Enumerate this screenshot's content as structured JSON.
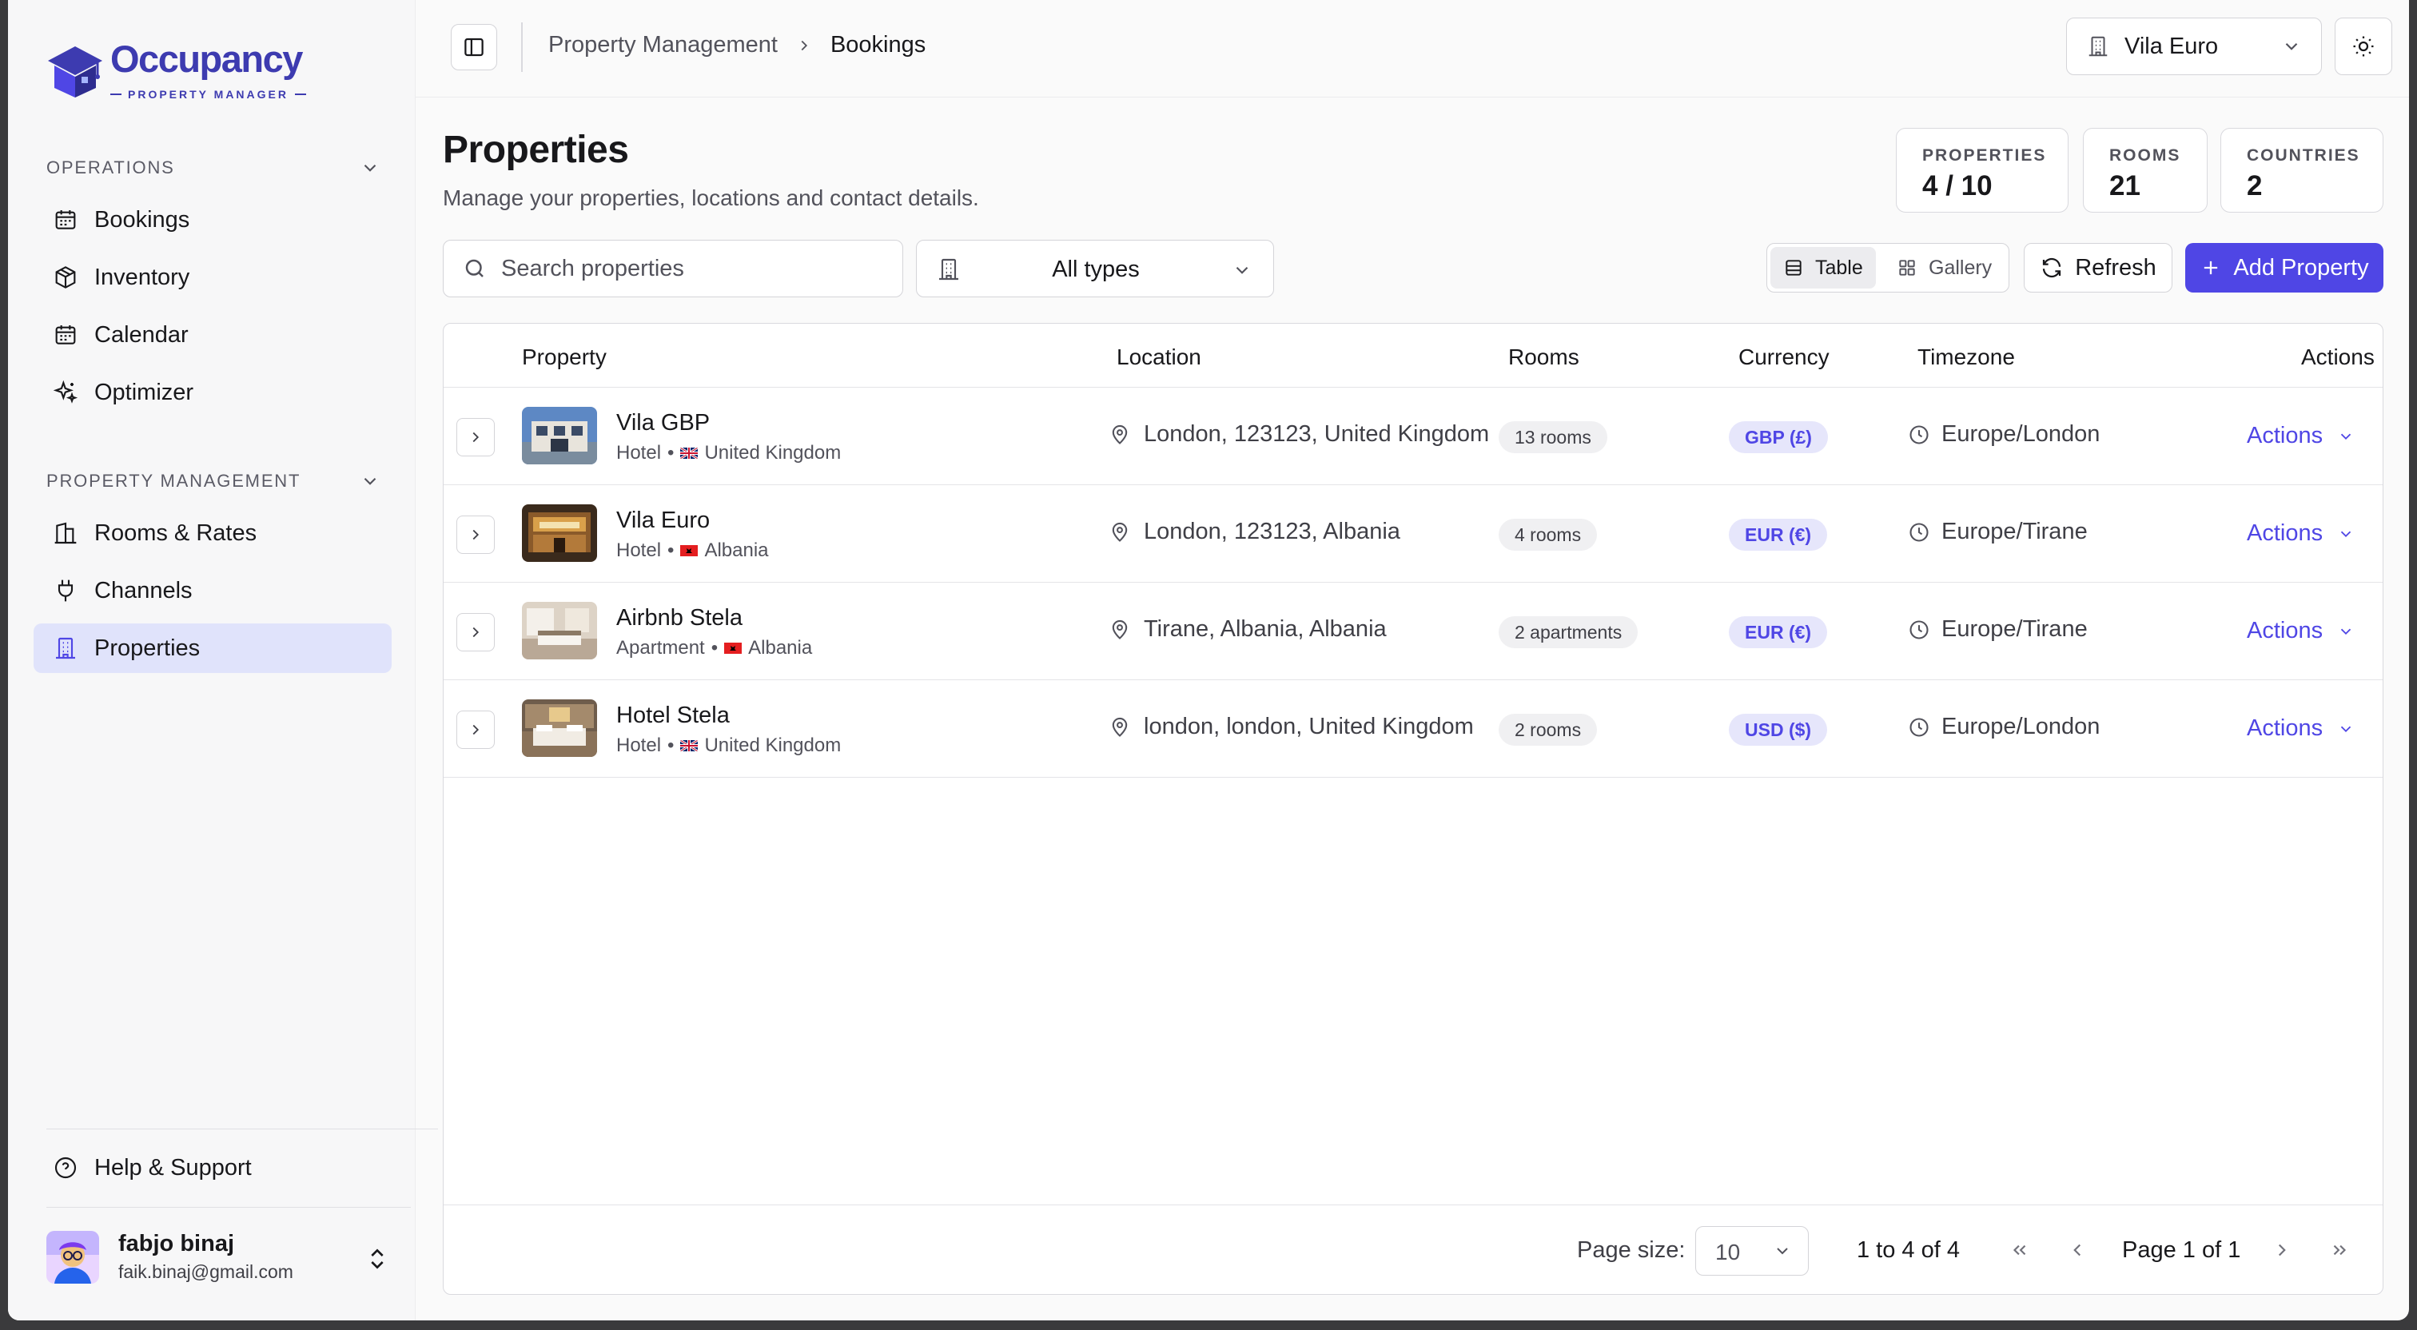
{
  "app": {
    "name": "Occupancy",
    "tagline": "PROPERTY MANAGER"
  },
  "sidebar": {
    "operations_label": "OPERATIONS",
    "operations_items": [
      {
        "label": "Bookings",
        "icon": "calendar-icon"
      },
      {
        "label": "Inventory",
        "icon": "box-icon"
      },
      {
        "label": "Calendar",
        "icon": "calendar-icon"
      },
      {
        "label": "Optimizer",
        "icon": "sparkles-icon"
      }
    ],
    "management_label": "PROPERTY MANAGEMENT",
    "management_items": [
      {
        "label": "Rooms & Rates",
        "icon": "building-icon"
      },
      {
        "label": "Channels",
        "icon": "plug-icon"
      },
      {
        "label": "Properties",
        "icon": "building-icon",
        "active": true
      }
    ],
    "help_label": "Help & Support",
    "user": {
      "name": "fabjo binaj",
      "email": "faik.binaj@gmail.com"
    }
  },
  "topbar": {
    "breadcrumb": [
      "Property Management",
      "Bookings"
    ],
    "property_selector": "Vila Euro"
  },
  "page": {
    "title": "Properties",
    "subtitle": "Manage your properties, locations and contact details."
  },
  "stats": [
    {
      "label": "PROPERTIES",
      "value": "4 / 10"
    },
    {
      "label": "ROOMS",
      "value": "21"
    },
    {
      "label": "COUNTRIES",
      "value": "2"
    }
  ],
  "toolbar": {
    "search_placeholder": "Search properties",
    "type_filter": "All types",
    "view_table": "Table",
    "view_gallery": "Gallery",
    "refresh": "Refresh",
    "add": "Add Property"
  },
  "table": {
    "columns": [
      "Property",
      "Location",
      "Rooms",
      "Currency",
      "Timezone",
      "Actions"
    ],
    "rows": [
      {
        "name": "Vila GBP",
        "type": "Hotel",
        "country": "United Kingdom",
        "location": "London, 123123, United Kingdom",
        "rooms": "13 rooms",
        "currency": "GBP (£)",
        "timezone": "Europe/London",
        "action": "Actions"
      },
      {
        "name": "Vila Euro",
        "type": "Hotel",
        "country": "Albania",
        "location": "London, 123123, Albania",
        "rooms": "4 rooms",
        "currency": "EUR (€)",
        "timezone": "Europe/Tirane",
        "action": "Actions"
      },
      {
        "name": "Airbnb Stela",
        "type": "Apartment",
        "country": "Albania",
        "location": "Tirane, Albania, Albania",
        "rooms": "2 apartments",
        "currency": "EUR (€)",
        "timezone": "Europe/Tirane",
        "action": "Actions"
      },
      {
        "name": "Hotel Stela",
        "type": "Hotel",
        "country": "United Kingdom",
        "location": "london, london, United Kingdom",
        "rooms": "2 rooms",
        "currency": "USD ($)",
        "timezone": "Europe/London",
        "action": "Actions"
      }
    ]
  },
  "pagination": {
    "page_size_label": "Page size:",
    "page_size": "10",
    "range": "1 to 4 of 4",
    "page_text": "Page 1 of 1"
  },
  "colors": {
    "accent": "#4f46e5",
    "brand": "#3d3bb0",
    "active_nav": "#e0e3fb"
  }
}
